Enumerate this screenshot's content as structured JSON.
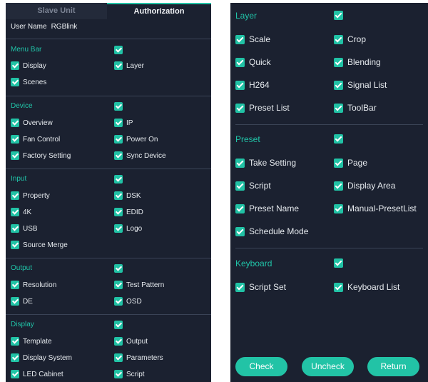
{
  "tabs": {
    "slave": "Slave Unit",
    "auth": "Authorization"
  },
  "user": {
    "label": "User Name",
    "value": "RGBlink"
  },
  "left_sections": {
    "menubar": {
      "title": "Menu Bar",
      "items": [
        "Display",
        "Layer",
        "Scenes"
      ]
    },
    "device": {
      "title": "Device",
      "items": [
        "Overview",
        "IP",
        "Fan Control",
        "Power On",
        "Factory Setting",
        "Sync Device"
      ]
    },
    "input": {
      "title": "Input",
      "items": [
        "Property",
        "DSK",
        "4K",
        "EDID",
        "USB",
        "Logo",
        "Source Merge"
      ]
    },
    "output": {
      "title": "Output",
      "items": [
        "Resolution",
        "Test Pattern",
        "DE",
        "OSD"
      ]
    },
    "display": {
      "title": "Display",
      "items": [
        "Template",
        "Output",
        "Display System",
        "Parameters",
        "LED Cabinet",
        "Script"
      ]
    }
  },
  "right_sections": {
    "layer": {
      "title": "Layer",
      "items": [
        "Scale",
        "Crop",
        "Quick",
        "Blending",
        "H264",
        "Signal List",
        "Preset List",
        "ToolBar"
      ]
    },
    "preset": {
      "title": "Preset",
      "items": [
        "Take Setting",
        "Page",
        "Script",
        "Display Area",
        "Preset Name",
        "Manual-PresetList",
        "Schedule Mode"
      ]
    },
    "keyboard": {
      "title": "Keyboard",
      "items": [
        "Script Set",
        "Keyboard List"
      ]
    }
  },
  "buttons": {
    "check": "Check",
    "uncheck": "Uncheck",
    "return": "Return"
  },
  "colors": {
    "panel_bg": "#1b2130",
    "accent": "#22c3a6",
    "divider": "#3a4356"
  }
}
